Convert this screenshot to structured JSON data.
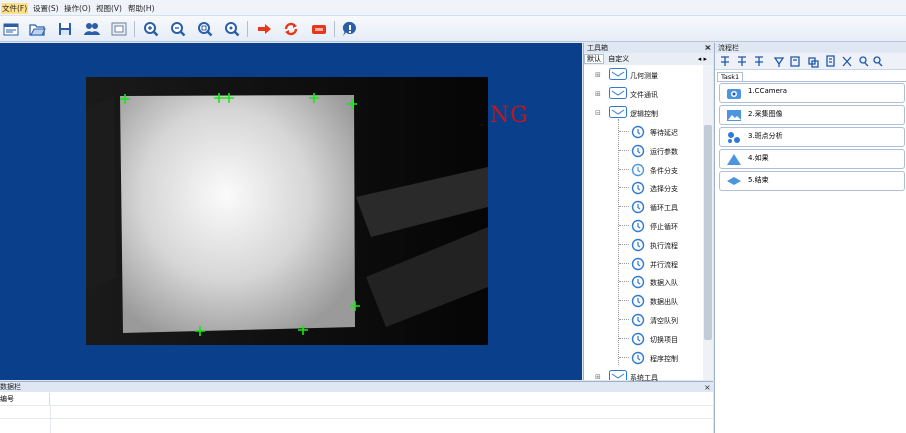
{
  "menu": [
    "文件(F)",
    "设置(S)",
    "操作(O)",
    "视图(V)",
    "帮助(H)"
  ],
  "view": {
    "result_text": "NG"
  },
  "toolbox": {
    "title": "工具箱",
    "close": "×",
    "tabs": [
      "默认",
      "自定义"
    ],
    "tab_arrows": "◂ ▸",
    "groups": [
      {
        "label": "几何测量",
        "expander": "⊞"
      },
      {
        "label": "文件通讯",
        "expander": "⊞"
      },
      {
        "label": "逻辑控制",
        "expander": "⊟"
      },
      {
        "label": "系统工具",
        "expander": "⊞"
      }
    ],
    "items": [
      "等待延迟",
      "运行参数",
      "条件分支",
      "选择分支",
      "循环工具",
      "停止循环",
      "执行流程",
      "并行流程",
      "数据入队",
      "数据出队",
      "清空队列",
      "切换项目",
      "程序控制"
    ]
  },
  "flow": {
    "title": "流程栏",
    "close": "×",
    "task_tab": "Task1",
    "steps": [
      "1.CCamera",
      "2.采集图像",
      "3.斑点分析",
      "4.如果",
      "5.结束"
    ]
  },
  "data_panel": {
    "title": "数据栏",
    "close": "×",
    "column_header": "编号"
  },
  "colors": {
    "viewport_bg": "#0a3f8c",
    "ng_red": "#c41818",
    "marker_green": "#19e619",
    "toolbar_red": "#e8361a",
    "icon_blue": "#2f7ad8"
  }
}
